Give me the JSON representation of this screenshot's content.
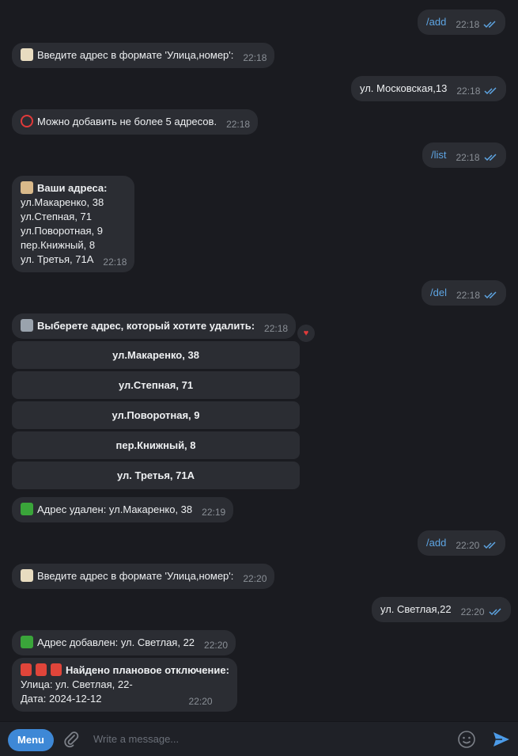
{
  "messages": {
    "m1": {
      "text": "/add",
      "time": "22:18"
    },
    "m2": {
      "text": "Введите адрес в формате 'Улица,номер':",
      "time": "22:18"
    },
    "m3": {
      "text": "ул. Московская,13",
      "time": "22:18"
    },
    "m4": {
      "text": "Можно добавить не более 5 адресов.",
      "time": "22:18"
    },
    "m5": {
      "text": "/list",
      "time": "22:18"
    },
    "m6": {
      "title": "Ваши адреса:",
      "lines": [
        "ул.Макаренко, 38",
        "ул.Степная, 71",
        "ул.Поворотная, 9",
        "пер.Книжный, 8",
        "ул. Третья, 71А"
      ],
      "time": "22:18"
    },
    "m7": {
      "text": "/del",
      "time": "22:18"
    },
    "m8": {
      "text": "Выберете адрес, который хотите удалить:",
      "time": "22:18"
    },
    "m9": {
      "text": "Адрес удален: ул.Макаренко, 38",
      "time": "22:19"
    },
    "m10": {
      "text": "/add",
      "time": "22:20"
    },
    "m11": {
      "text": "Введите адрес в формате 'Улица,номер':",
      "time": "22:20"
    },
    "m12": {
      "text": "ул. Светлая,22",
      "time": "22:20"
    },
    "m13": {
      "text": "Адрес добавлен: ул. Светлая, 22",
      "time": "22:20"
    },
    "m14": {
      "title": "Найдено плановое отключение:",
      "lines": [
        "Улица: ул. Светлая, 22-",
        "Дата: 2024-12-12"
      ],
      "time": "22:20"
    }
  },
  "keyboard": [
    "ул.Макаренко, 38",
    "ул.Степная, 71",
    "ул.Поворотная, 9",
    "пер.Книжный, 8",
    "ул. Третья, 71А"
  ],
  "composer": {
    "menu_label": "Menu",
    "placeholder": "Write a message..."
  }
}
